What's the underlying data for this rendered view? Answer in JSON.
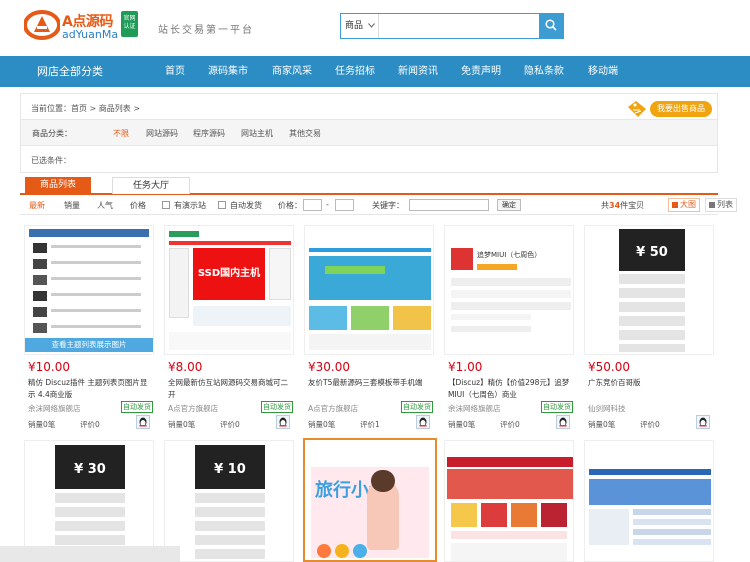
{
  "header": {
    "logo_cn": "A点源码",
    "logo_en": "adYuanMa",
    "logo_badge": "官网\n认证",
    "slogan": "站长交易第一平台",
    "search_select": "商品",
    "search_placeholder": ""
  },
  "nav": {
    "all_categories": "网店全部分类",
    "items": [
      "首页",
      "源码集市",
      "商家风采",
      "任务招标",
      "新闻资讯",
      "免责声明",
      "隐私条款",
      "移动端"
    ]
  },
  "catbox": {
    "breadcrumb": "当前位置：首页 > 商品列表 >",
    "cat_label": "商品分类：",
    "cats": [
      "不限",
      "网站源码",
      "程序源码",
      "网站主机",
      "其他交易"
    ],
    "selected_label": "已选条件：",
    "sell_button": "我要出售商品"
  },
  "tabs": [
    "商品列表",
    "任务大厅"
  ],
  "filter": {
    "sorts": [
      "最新",
      "销量",
      "人气",
      "价格"
    ],
    "demo_label": "有演示站",
    "auto_label": "自动发货",
    "price_label": "价格：",
    "price_sep": "-",
    "keyword_label": "关键字：",
    "confirm": "确定",
    "total_prefix": "共",
    "total_count": "34",
    "total_suffix": "件宝贝",
    "view_big": "大图",
    "view_list": "列表"
  },
  "products": [
    {
      "price": "¥10.00",
      "title": "精仿 Discuz插件 主题列表页图片显示 4.4商业版",
      "shop": "余沫网络旗舰店",
      "auto": "自动发货",
      "sales": "销量0笔",
      "rating": "评价0",
      "thumb_caption": "查看主题列表展示图片"
    },
    {
      "price": "¥8.00",
      "title": "全网最新仿互站网源码交易商城可二开",
      "shop": "A点官方旗舰店",
      "auto": "自动发货",
      "sales": "销量0笔",
      "rating": "评价0",
      "thumb_caption": "SSD国内主机"
    },
    {
      "price": "¥30.00",
      "title": "友价T5最新源码三套模板带手机端",
      "shop": "A点官方旗舰店",
      "auto": "自动发货",
      "sales": "销量0笔",
      "rating": "评价1",
      "thumb_caption": ""
    },
    {
      "price": "¥1.00",
      "title": "【Discuz】精仿【价值298元】追梦MIUI（七周色）商业",
      "shop": "余沫网络旗舰店",
      "auto": "自动发货",
      "sales": "销量0笔",
      "rating": "评价0",
      "thumb_caption": "追梦MIUI（七周色）"
    },
    {
      "price": "¥50.00",
      "title": "广东竞价百哥版",
      "shop": "仙剑网科技",
      "auto": "",
      "sales": "销量0笔",
      "rating": "评价0",
      "thumb_caption": "¥ 50"
    },
    {
      "price": "",
      "title": "",
      "shop": "",
      "auto": "",
      "sales": "",
      "rating": "",
      "thumb_caption": "¥ 30"
    },
    {
      "price": "",
      "title": "",
      "shop": "",
      "auto": "",
      "sales": "",
      "rating": "",
      "thumb_caption": "¥ 10"
    },
    {
      "price": "",
      "title": "",
      "shop": "",
      "auto": "",
      "sales": "",
      "rating": "",
      "thumb_caption": "旅行小记"
    },
    {
      "price": "",
      "title": "",
      "shop": "",
      "auto": "",
      "sales": "",
      "rating": "",
      "thumb_caption": ""
    },
    {
      "price": "",
      "title": "",
      "shop": "",
      "auto": "",
      "sales": "",
      "rating": "",
      "thumb_caption": ""
    }
  ],
  "colors": {
    "brand_blue": "#2c8dc4",
    "accent_orange": "#e65a17",
    "price_red": "#d7000f",
    "auto_green": "#2e9a3c"
  }
}
